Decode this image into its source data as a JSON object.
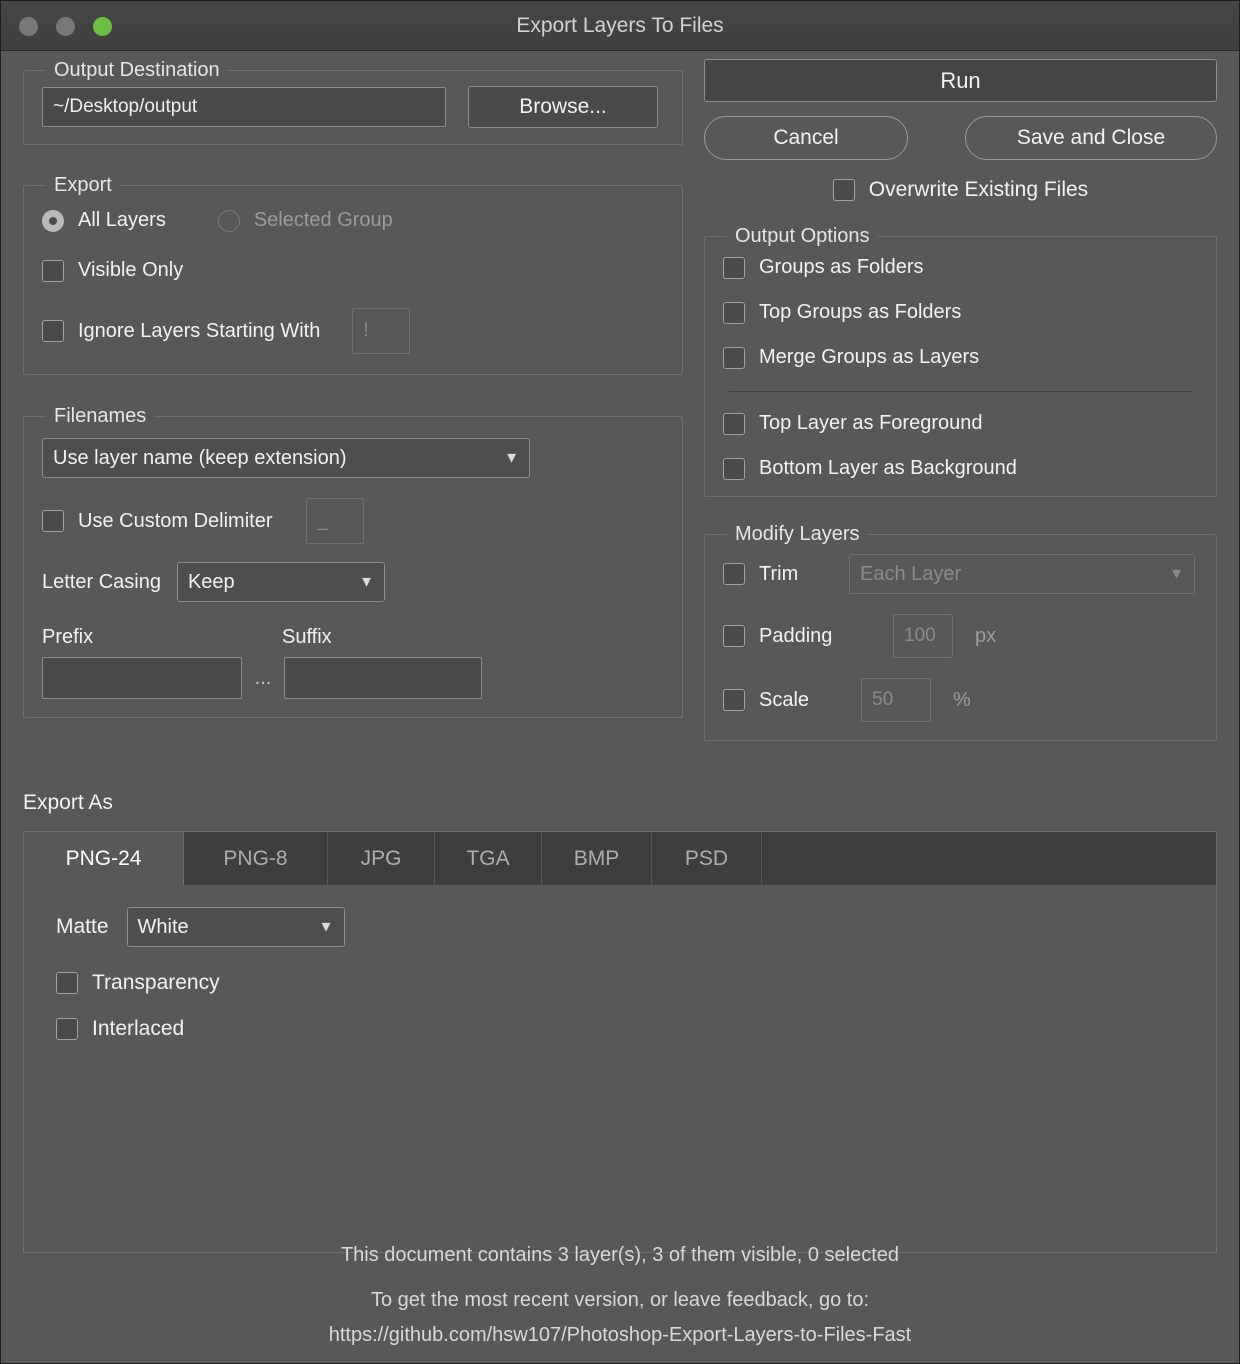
{
  "window": {
    "title": "Export Layers To Files",
    "traffic_lights": [
      "close-gray",
      "minimize-gray",
      "zoom-green"
    ]
  },
  "output_destination": {
    "legend": "Output Destination",
    "path_value": "~/Desktop/output",
    "path_placeholder": "~/Desktop/output",
    "browse_label": "Browse..."
  },
  "actions": {
    "run_label": "Run",
    "cancel_label": "Cancel",
    "save_close_label": "Save and Close",
    "overwrite_label": "Overwrite Existing Files"
  },
  "export": {
    "legend": "Export",
    "all_layers_label": "All Layers",
    "selected_group_label": "Selected Group",
    "visible_only_label": "Visible Only",
    "ignore_label": "Ignore Layers Starting With",
    "ignore_value": "!"
  },
  "output_options": {
    "legend": "Output Options",
    "groups_as_folders": "Groups as Folders",
    "top_groups_as_folders": "Top Groups as Folders",
    "merge_groups_as_layers": "Merge Groups as Layers",
    "top_layer_as_foreground": "Top Layer as Foreground",
    "bottom_layer_as_background": "Bottom Layer as Background"
  },
  "filenames": {
    "legend": "Filenames",
    "naming_value": "Use layer name (keep extension)",
    "naming_options": [
      "Use layer name (keep extension)"
    ],
    "custom_delimiter_label": "Use Custom Delimiter",
    "custom_delimiter_value": "_",
    "letter_casing_label": "Letter Casing",
    "letter_casing_value": "Keep",
    "letter_casing_options": [
      "Keep"
    ],
    "prefix_label": "Prefix",
    "prefix_value": "",
    "separator": "...",
    "suffix_label": "Suffix",
    "suffix_value": ""
  },
  "modify_layers": {
    "legend": "Modify Layers",
    "trim_label": "Trim",
    "trim_value": "Each Layer",
    "trim_options": [
      "Each Layer"
    ],
    "padding_label": "Padding",
    "padding_value": "100",
    "padding_unit": "px",
    "scale_label": "Scale",
    "scale_value": "50",
    "scale_unit": "%"
  },
  "export_as": {
    "section_label": "Export As",
    "tabs": [
      {
        "label": "PNG-24",
        "active": true
      },
      {
        "label": "PNG-8",
        "active": false
      },
      {
        "label": "JPG",
        "active": false
      },
      {
        "label": "TGA",
        "active": false
      },
      {
        "label": "BMP",
        "active": false
      },
      {
        "label": "PSD",
        "active": false
      }
    ],
    "panel": {
      "matte_label": "Matte",
      "matte_value": "White",
      "matte_options": [
        "White"
      ],
      "transparency_label": "Transparency",
      "interlaced_label": "Interlaced"
    }
  },
  "footer": {
    "line1": "This document contains 3 layer(s), 3 of them visible, 0 selected",
    "line2": "To get the most recent version, or leave feedback, go to:",
    "line3": "https://github.com/hsw107/Photoshop-Export-Layers-to-Files-Fast"
  },
  "colors": {
    "window_bg": "#585858",
    "titlebar_bg": "#454545",
    "field_bg": "#4a4a4a",
    "border": "#6e6e6e",
    "text": "#f2f2f2",
    "text_disabled": "#8c8c8c",
    "green_light": "#6dbf42",
    "gray_light": "#787878"
  }
}
